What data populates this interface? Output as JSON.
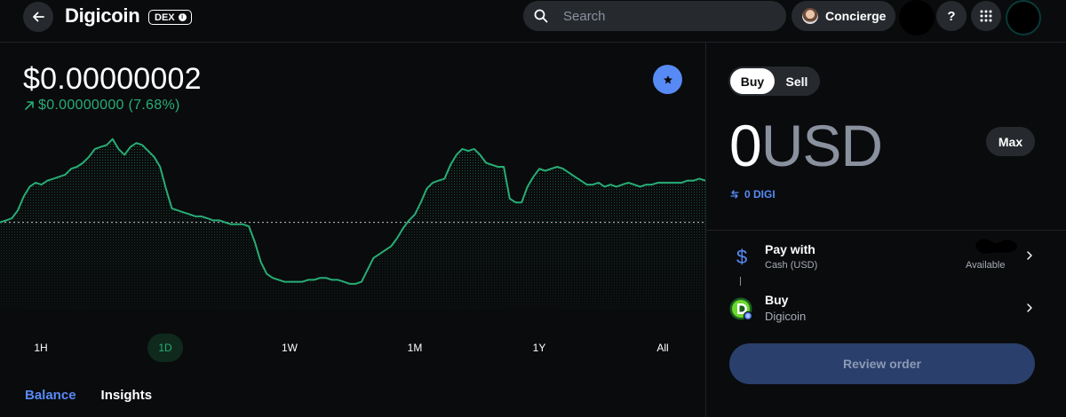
{
  "header": {
    "back_icon": "arrow-left-icon",
    "title": "Digicoin",
    "badge": "DEX",
    "search": {
      "placeholder": "Search",
      "value": ""
    },
    "concierge_label": "Concierge",
    "help_label": "?",
    "apps_icon": "grid-icon"
  },
  "asset": {
    "price": "$0.00000002",
    "change": "$0.00000000 (7.68%)",
    "change_direction": "up",
    "change_color": "#27ad75",
    "favorite_icon": "star-icon"
  },
  "chart_data": {
    "type": "area",
    "color": "#27ad75",
    "reference_line": "dotted",
    "x": [
      0,
      1,
      2,
      3,
      4,
      5,
      6,
      7,
      8,
      9,
      10,
      11,
      12,
      13,
      14,
      15,
      16,
      17,
      18,
      19,
      20,
      21,
      22,
      23,
      24,
      25,
      26,
      27,
      28,
      29,
      30,
      31,
      32,
      33,
      34,
      35,
      36,
      37,
      38,
      39,
      40,
      41,
      42,
      43,
      44,
      45,
      46,
      47,
      48,
      49,
      50,
      51,
      52,
      53,
      54,
      55,
      56,
      57,
      58,
      59,
      60,
      61,
      62,
      63,
      64,
      65,
      66,
      67,
      68,
      69,
      70,
      71,
      72,
      73,
      74,
      75,
      76,
      77,
      78,
      79,
      80,
      81,
      82,
      83,
      84,
      85,
      86,
      87,
      88,
      89,
      90,
      91,
      92,
      93,
      94,
      95,
      96,
      97,
      98,
      99,
      100,
      101,
      102,
      103,
      104,
      105,
      106,
      107,
      108,
      109,
      110,
      111,
      112,
      113,
      114,
      115,
      116,
      117,
      118,
      119
    ],
    "y": [
      100,
      101,
      102,
      106,
      113,
      118,
      120,
      119,
      121,
      122,
      123,
      124,
      127,
      128,
      130,
      133,
      137,
      138,
      139,
      142,
      137,
      134,
      138,
      140,
      139,
      136,
      133,
      128,
      117,
      107,
      106,
      105,
      104,
      103,
      103,
      102,
      101,
      101,
      100,
      99,
      99,
      99,
      98,
      90,
      80,
      74,
      72,
      71,
      70,
      70,
      70,
      70,
      71,
      71,
      72,
      72,
      71,
      71,
      70,
      69,
      69,
      70,
      76,
      82,
      84,
      86,
      88,
      92,
      97,
      101,
      104,
      110,
      117,
      120,
      121,
      122,
      129,
      134,
      137,
      136,
      137,
      134,
      130,
      129,
      128,
      128,
      112,
      110,
      110,
      118,
      123,
      127,
      126,
      127,
      128,
      127,
      125,
      123,
      121,
      119,
      119,
      120,
      118,
      119,
      118,
      119,
      120,
      119,
      118,
      119,
      119,
      120,
      120,
      120,
      120,
      120,
      121,
      121,
      122,
      121
    ],
    "baseline": 100,
    "ranges": [
      "1H",
      "1D",
      "1W",
      "1M",
      "1Y",
      "All"
    ],
    "selected_range": "1D"
  },
  "tabs": [
    {
      "label": "Balance",
      "active": true
    },
    {
      "label": "Insights",
      "active": false
    }
  ],
  "trade": {
    "mode_buy": "Buy",
    "mode_sell": "Sell",
    "selected_mode": "Buy",
    "amount_value": "0",
    "amount_currency": "USD",
    "max_label": "Max",
    "conversion": "0 DIGI",
    "pay_with": {
      "title": "Pay with",
      "subtitle": "Cash (USD)",
      "balance_status": "Available",
      "icon": "dollar-icon"
    },
    "buy_asset": {
      "title": "Buy",
      "subtitle": "Digicoin",
      "icon": "digicoin-logo-icon"
    },
    "review_label": "Review order"
  },
  "colors": {
    "background": "#0a0b0d",
    "surface": "#26292e",
    "accent_blue": "#588af5",
    "positive_green": "#27ad75",
    "review_button": "#2a3f6b"
  }
}
